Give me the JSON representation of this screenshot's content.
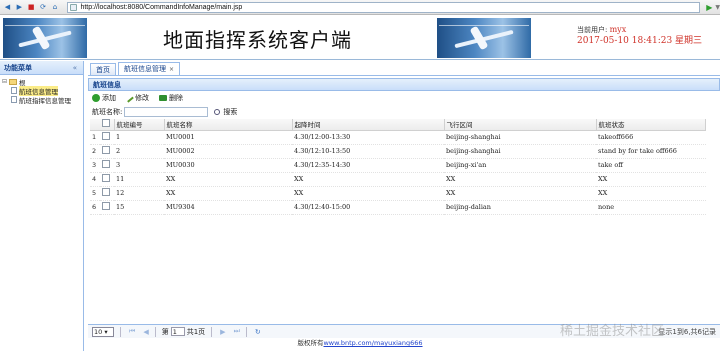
{
  "browser": {
    "url": "http://localhost:8080/CommandInfoManage/main.jsp"
  },
  "header": {
    "title": "地面指挥系统客户端",
    "user_label": "当前用户:",
    "user_name": "myx",
    "datetime": "2017-05-10 18:41:23 星期三"
  },
  "sidebar": {
    "title": "功能菜单",
    "collapse_glyph": "«",
    "root": "根",
    "items": [
      {
        "label": "航班信息管理",
        "selected": true
      },
      {
        "label": "航班指挥信息管理",
        "selected": false
      }
    ]
  },
  "tabs": [
    {
      "label": "首页",
      "active": false
    },
    {
      "label": "航班信息管理",
      "active": true
    }
  ],
  "panel": {
    "title": "航班信息"
  },
  "toolbar": {
    "add_label": "添加",
    "edit_label": "修改",
    "delete_label": "删除"
  },
  "search": {
    "label": "航班名称:",
    "button_label": "搜索"
  },
  "table": {
    "columns": [
      "航班编号",
      "航班名称",
      "起降时间",
      "飞行区间",
      "航班状态"
    ],
    "rows": [
      {
        "n": "1",
        "id": "1",
        "name": "MU0001",
        "time": "4.30/12:00-13:30",
        "route": "beijing-shanghai",
        "status": "takeoff666"
      },
      {
        "n": "2",
        "id": "2",
        "name": "MU0002",
        "time": "4.30/12:10-13:50",
        "route": "beijing-shanghai",
        "status": "stand by for take off666"
      },
      {
        "n": "3",
        "id": "3",
        "name": "MU0030",
        "time": "4.30/12:35-14:30",
        "route": "beijing-xi'an",
        "status": "take off"
      },
      {
        "n": "4",
        "id": "11",
        "name": "XX",
        "time": "XX",
        "route": "XX",
        "status": "XX"
      },
      {
        "n": "5",
        "id": "12",
        "name": "XX",
        "time": "XX",
        "route": "XX",
        "status": "XX"
      },
      {
        "n": "6",
        "id": "15",
        "name": "MU9304",
        "time": "4.30/12:40-15:00",
        "route": "beijing-dalian",
        "status": "none"
      }
    ]
  },
  "pager": {
    "page_size": "10",
    "page_prefix": "第",
    "page_value": "1",
    "page_suffix": "共1页",
    "info": "显示1到6,共6记录"
  },
  "footer": {
    "prefix": "版权所有",
    "link": "www.bntp.com/mayuxiang666"
  },
  "watermark": "稀土掘金技术社区"
}
